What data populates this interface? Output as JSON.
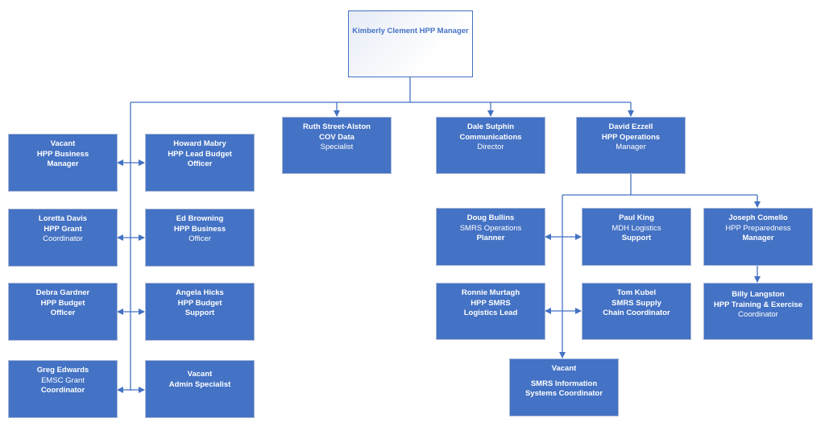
{
  "chart": {
    "top": {
      "name": "Kimberly Clement",
      "title": "HPP Manager"
    },
    "direct_reports": [
      {
        "id": "ruth",
        "lines": [
          "Ruth Street-Alston",
          "COV Data",
          "Specialist"
        ]
      },
      {
        "id": "dale",
        "lines": [
          "Dale Sutphin",
          "Communications",
          "Director"
        ]
      },
      {
        "id": "david",
        "lines": [
          "David Ezzell",
          "HPP Operations",
          "Manager"
        ]
      }
    ],
    "left_pairs": [
      {
        "left": [
          "Vacant",
          "HPP Business",
          "Manager"
        ],
        "right": [
          "Howard Mabry",
          "HPP Lead Budget",
          "Officer"
        ]
      },
      {
        "left": [
          "Loretta Davis",
          "HPP Grant",
          "Coordinator"
        ],
        "right": [
          "Ed Browning",
          "HPP Business",
          "Officer"
        ]
      },
      {
        "left": [
          "Debra Gardner",
          "HPP Budget",
          "Officer"
        ],
        "right": [
          "Angela Hicks",
          "HPP Budget",
          "Support"
        ]
      },
      {
        "left": [
          "Greg Edwards",
          "EMSC Grant",
          "Coordinator"
        ],
        "right": [
          "Vacant",
          "Admin Specialist"
        ]
      }
    ],
    "operations_pairs": [
      {
        "left": [
          "Doug Bullins",
          "SMRS Operations",
          "Planner"
        ],
        "right": [
          "Paul King",
          "MDH Logistics",
          "Support"
        ]
      },
      {
        "left": [
          "Ronnie Murtagh",
          "HPP SMRS",
          "Logistics Lead"
        ],
        "right": [
          "Tom Kubel",
          "SMRS Supply",
          "Chain Coordinator"
        ]
      }
    ],
    "preparedness": {
      "manager": [
        "Joseph Comello",
        "HPP Preparedness",
        "Manager"
      ],
      "report": [
        "Billy Langston",
        "HPP Training & Exercise",
        "Coordinator"
      ]
    },
    "smrs_info": {
      "line1": "Vacant",
      "line2": "SMRS Information",
      "line3": "Systems Coordinator"
    }
  },
  "colors": {
    "box_fill": "#4472c4",
    "connector": "#4472c4",
    "top_text": "#4472c4"
  }
}
